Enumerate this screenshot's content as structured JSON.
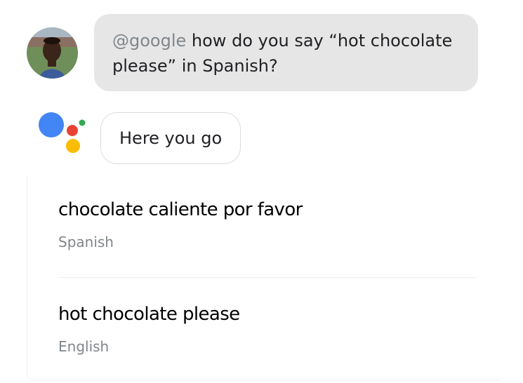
{
  "conversation": {
    "user_message": {
      "mention": "@google",
      "text": " how do you say “hot chocolate please” in Spanish?"
    },
    "assistant_reply": {
      "text": "Here you go"
    }
  },
  "translation_card": {
    "translated": {
      "phrase": "chocolate caliente por favor",
      "language": "Spanish"
    },
    "original": {
      "phrase": "hot chocolate please",
      "language": "English"
    }
  },
  "icons": {
    "avatar": "user-avatar-photo",
    "assistant": "google-assistant-logo"
  },
  "colors": {
    "user_bubble_bg": "#e6e6e6",
    "mention": "#80868b",
    "assistant_blue": "#4285f4",
    "assistant_red": "#ea4335",
    "assistant_yellow": "#fbbc04",
    "assistant_green": "#34a853",
    "secondary_text": "#80868b"
  }
}
